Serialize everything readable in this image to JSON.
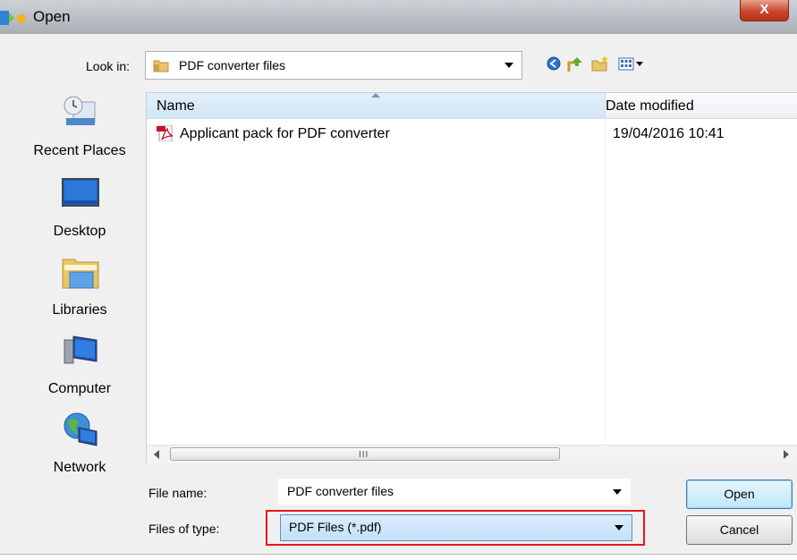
{
  "window": {
    "title": "Open",
    "close_symbol": "X"
  },
  "toolbar": {
    "look_in_label": "Look in:",
    "look_in_value": "PDF converter files",
    "icons": [
      "back-icon",
      "up-folder-icon",
      "new-folder-icon",
      "view-menu-icon"
    ]
  },
  "places": [
    {
      "label": "Recent Places",
      "icon": "recent-places-icon"
    },
    {
      "label": "Desktop",
      "icon": "desktop-icon"
    },
    {
      "label": "Libraries",
      "icon": "libraries-icon"
    },
    {
      "label": "Computer",
      "icon": "computer-icon"
    },
    {
      "label": "Network",
      "icon": "network-icon"
    }
  ],
  "file_list": {
    "columns": [
      "Name",
      "Date modified"
    ],
    "rows": [
      {
        "name": "Applicant pack for PDF converter",
        "date": "19/04/2016 10:41",
        "icon": "pdf-file-icon"
      }
    ],
    "scroll_grip": "III"
  },
  "form": {
    "file_name_label": "File name:",
    "file_name_value": "PDF converter files",
    "file_type_label": "Files of type:",
    "file_type_value": "PDF Files (*.pdf)"
  },
  "buttons": {
    "open": "Open",
    "cancel": "Cancel"
  },
  "colors": {
    "highlight": "#e0191c",
    "close_button": "#c9472c",
    "selected_combo": "#c2e0f8"
  }
}
